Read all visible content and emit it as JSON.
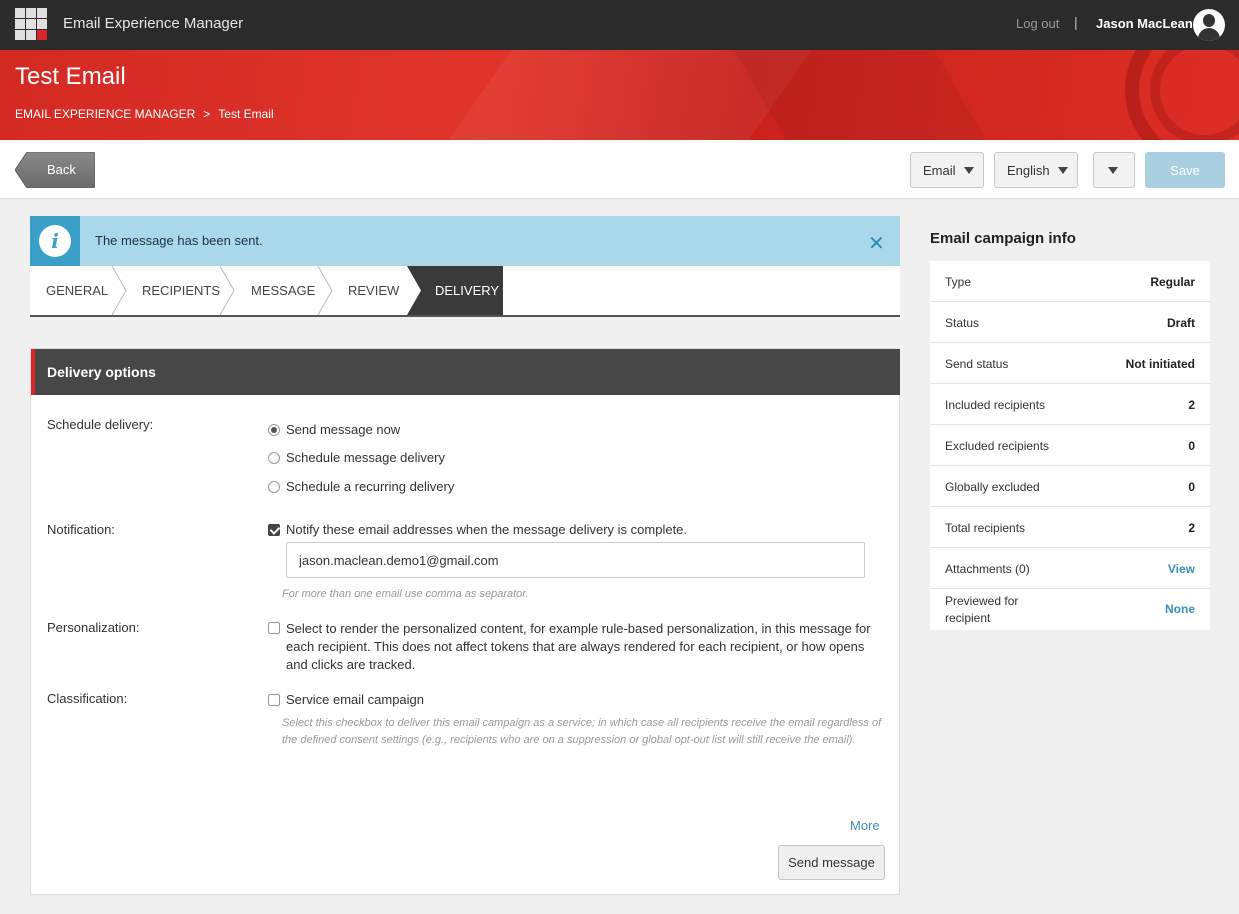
{
  "topbar": {
    "app_title": "Email Experience Manager",
    "logout": "Log out",
    "separator": "|",
    "user_name": "Jason MacLean"
  },
  "header": {
    "title": "Test Email",
    "breadcrumb": [
      "EMAIL EXPERIENCE MANAGER",
      "Test Email"
    ],
    "breadcrumb_separator": ">"
  },
  "toolbar": {
    "back_label": "Back",
    "channel_select": "Email",
    "language_select": "English",
    "save_label": "Save"
  },
  "notice": {
    "message": "The message has been sent.",
    "close_symbol": "✕"
  },
  "steps": [
    "GENERAL",
    "RECIPIENTS",
    "MESSAGE",
    "REVIEW",
    "DELIVERY"
  ],
  "active_step": "DELIVERY",
  "delivery": {
    "heading": "Delivery options",
    "schedule_label": "Schedule delivery:",
    "schedule_options": [
      "Send message now",
      "Schedule message delivery",
      "Schedule a recurring delivery"
    ],
    "schedule_selected": "Send message now",
    "notification_label": "Notification:",
    "notification_checkbox": "Notify these email addresses when the message delivery is complete.",
    "notification_checked": true,
    "notification_email": "jason.maclean.demo1@gmail.com",
    "notification_hint": "For more than one email use comma as separator.",
    "personalization_label": "Personalization:",
    "personalization_checkbox": "Select to render the personalized content, for example rule-based personalization, in this message for each recipient. This does not affect tokens that are always rendered for each recipient, or how opens and clicks are tracked.",
    "personalization_checked": false,
    "classification_label": "Classification:",
    "classification_checkbox": "Service email campaign",
    "classification_checked": false,
    "classification_hint": "Select this checkbox to deliver this email campaign as a service; in which case all recipients receive the email regardless of the defined consent settings (e.g., recipients who are on a suppression or global opt-out list will still receive the email).",
    "more_link": "More",
    "send_button": "Send message"
  },
  "campaign_info": {
    "title": "Email campaign info",
    "rows": [
      {
        "label": "Type",
        "value": "Regular"
      },
      {
        "label": "Status",
        "value": "Draft"
      },
      {
        "label": "Send status",
        "value": "Not initiated"
      },
      {
        "label": "Included recipients",
        "value": "2"
      },
      {
        "label": "Excluded recipients",
        "value": "0"
      },
      {
        "label": "Globally excluded",
        "value": "0"
      },
      {
        "label": "Total recipients",
        "value": "2"
      },
      {
        "label": "Attachments (0)",
        "value": "View"
      },
      {
        "label": "Previewed for recipient",
        "value": "None"
      }
    ]
  },
  "colors": {
    "brand_red": "#d9262b",
    "topbar": "#2b2b2b",
    "info_bg": "#a8d8ea",
    "info_accent": "#3aa0c8",
    "link": "#3a8fb8",
    "save_disabled": "#a9cfe0"
  },
  "icons": [
    "app-grid-icon",
    "avatar-icon",
    "info-icon",
    "close-icon",
    "caret-down-icon"
  ]
}
